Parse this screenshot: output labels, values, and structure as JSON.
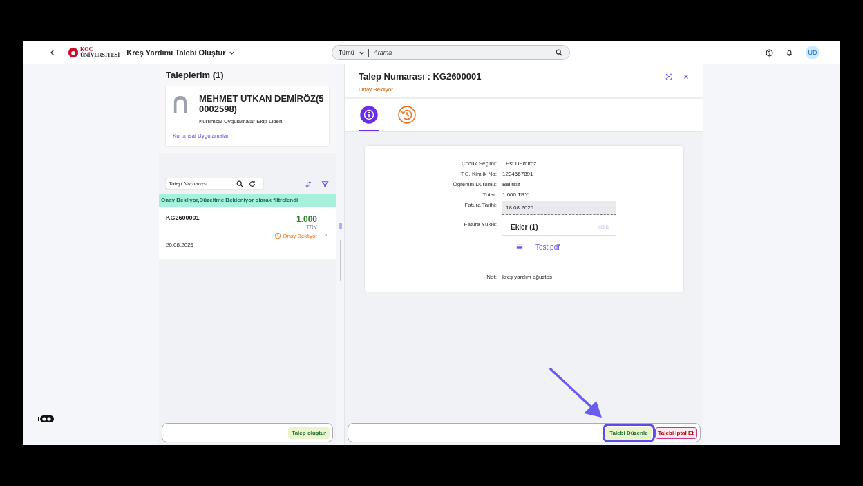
{
  "header": {
    "logo_top": "KOÇ",
    "logo_bottom": "ÜNİVERSİTESİ",
    "app_title": "Kreş Yardımı Talebi Oluştur",
    "search": {
      "scope": "Tümü",
      "placeholder": "Arama"
    },
    "avatar": "UD"
  },
  "list_panel": {
    "title": "Taleplerim (1)",
    "profile": {
      "name": "MEHMET UTKAN DEMİRÖZ(50002598)",
      "role": "Kurumsal Uygulamalar Ekip Lideri",
      "department": "Kurumsal Uygulamalar"
    },
    "search": {
      "placeholder": "Talep Numarası"
    },
    "filter_info": "Onay Bekliyor,Düzeltme Bekleniyor olarak filtrelendi",
    "items": [
      {
        "id": "KG2600001",
        "amount": "1.000",
        "currency": "TRY",
        "status": "Onay Bekliyor",
        "date": "20.08.2026",
        "selected": false
      }
    ],
    "footer_button": "Talep oluştur"
  },
  "detail_panel": {
    "title": "Talep Numarası : KG2600001",
    "status": "Onay Bekliyor",
    "tabs": [
      {
        "kind": "info",
        "selected": true
      },
      {
        "kind": "history",
        "selected": false
      }
    ],
    "fields": [
      {
        "kind": "text",
        "label": "Çocuk Seçimi:",
        "value": "TEst DEmiröz"
      },
      {
        "kind": "text",
        "label": "T.C. Kimlik No:",
        "value": "1234567891"
      },
      {
        "kind": "text",
        "label": "Öğrenim Durumu:",
        "value": "Belirsiz"
      },
      {
        "kind": "text",
        "label": "Tutar:",
        "value": "1.000 TRY"
      },
      {
        "kind": "date",
        "label": "Fatura Tarihi:",
        "value": "18.08.2026"
      },
      {
        "kind": "attachments",
        "label": "Fatura Yükle:",
        "title": "Ekler (1)",
        "upload": "Yükle",
        "files": [
          "Test.pdf"
        ]
      },
      {
        "kind": "note",
        "label": "Not:",
        "value": "kreş yardım ağustos"
      }
    ],
    "buttons": [
      {
        "kind": "accept",
        "label": "Talebi Düzenle",
        "focused": true
      },
      {
        "kind": "reject",
        "label": "Talebi İptal Et",
        "focused": false
      }
    ]
  }
}
